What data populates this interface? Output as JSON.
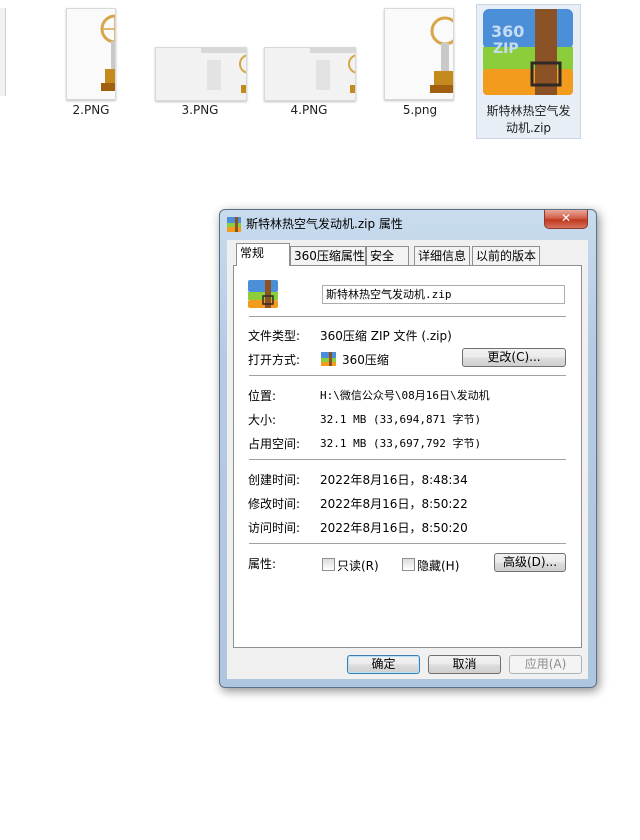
{
  "files": [
    {
      "name": "2.PNG"
    },
    {
      "name": "3.PNG"
    },
    {
      "name": "4.PNG"
    },
    {
      "name": "5.png"
    },
    {
      "name_line1": "斯特林热空气发",
      "name_line2": "动机.zip"
    }
  ],
  "zip_thumb_text": {
    "line1": "360",
    "line2": "ZIP"
  },
  "dialog": {
    "title": "斯特林热空气发动机.zip 属性",
    "close_glyph": "✕",
    "tabs": [
      "常规",
      "360压缩属性",
      "安全",
      "详细信息",
      "以前的版本"
    ],
    "filename": "斯特林热空气发动机.zip",
    "labels": {
      "type": "文件类型:",
      "open_with": "打开方式:",
      "location": "位置:",
      "size": "大小:",
      "size_on_disk": "占用空间:",
      "created": "创建时间:",
      "modified": "修改时间:",
      "accessed": "访问时间:",
      "attributes": "属性:"
    },
    "values": {
      "type": "360压缩 ZIP 文件 (.zip)",
      "open_with": "360压缩",
      "location": "H:\\微信公众号\\08月16日\\发动机",
      "size": "32.1 MB (33,694,871 字节)",
      "size_on_disk": "32.1 MB (33,697,792 字节)",
      "created": "2022年8月16日，8:48:34",
      "modified": "2022年8月16日，8:50:22",
      "accessed": "2022年8月16日，8:50:20"
    },
    "checkboxes": {
      "readonly": "只读(R)",
      "hidden": "隐藏(H)"
    },
    "buttons": {
      "change": "更改(C)...",
      "advanced": "高级(D)...",
      "ok": "确定",
      "cancel": "取消",
      "apply": "应用(A)"
    }
  }
}
